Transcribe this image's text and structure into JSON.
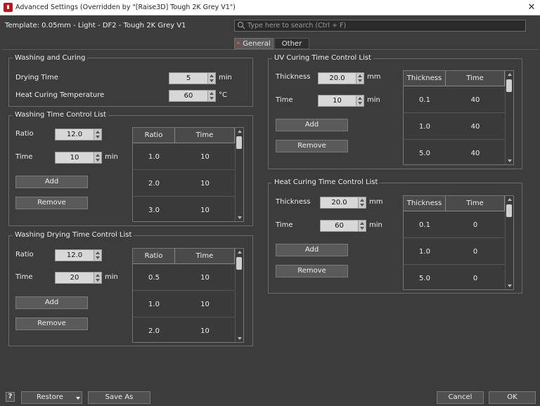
{
  "window": {
    "title": "Advanced Settings (Overridden by \"[Raise3D] Tough 2K Grey V1\")",
    "close_glyph": "✕"
  },
  "template_label": "Template: 0.05mm - Light - DF2 - Tough 2K Grey V1",
  "search": {
    "placeholder": "Type here to search (Ctrl + F)",
    "value": ""
  },
  "tabs": [
    {
      "label": "General",
      "active": true
    },
    {
      "label": "Other",
      "active": false
    }
  ],
  "accent_color": "#e24a3a",
  "washing_curing": {
    "title": "Washing and Curing",
    "drying_time": {
      "label": "Drying Time",
      "value": "5",
      "unit": "min"
    },
    "heat_curing_temp": {
      "label": "Heat Curing Temperature",
      "value": "60",
      "unit": "°C"
    }
  },
  "washing_time": {
    "title": "Washing Time Control List",
    "ratio": {
      "label": "Ratio",
      "value": "12.0"
    },
    "time": {
      "label": "Time",
      "value": "10",
      "unit": "min"
    },
    "add_label": "Add",
    "remove_label": "Remove",
    "columns": [
      "Ratio",
      "Time"
    ],
    "rows": [
      [
        "1.0",
        "10"
      ],
      [
        "2.0",
        "10"
      ],
      [
        "3.0",
        "10"
      ]
    ]
  },
  "washing_drying": {
    "title": "Washing Drying Time Control List",
    "ratio": {
      "label": "Ratio",
      "value": "12.0"
    },
    "time": {
      "label": "Time",
      "value": "20",
      "unit": "min"
    },
    "add_label": "Add",
    "remove_label": "Remove",
    "columns": [
      "Ratio",
      "Time"
    ],
    "rows": [
      [
        "0.5",
        "10"
      ],
      [
        "1.0",
        "10"
      ],
      [
        "2.0",
        "10"
      ]
    ]
  },
  "uv_curing": {
    "title": "UV Curing Time Control List",
    "thickness": {
      "label": "Thickness",
      "value": "20.0",
      "unit": "mm"
    },
    "time": {
      "label": "Time",
      "value": "10",
      "unit": "min"
    },
    "add_label": "Add",
    "remove_label": "Remove",
    "columns": [
      "Thickness",
      "Time"
    ],
    "rows": [
      [
        "0.1",
        "40"
      ],
      [
        "1.0",
        "40"
      ],
      [
        "5.0",
        "40"
      ]
    ]
  },
  "heat_curing": {
    "title": "Heat Curing Time Control List",
    "thickness": {
      "label": "Thickness",
      "value": "20.0",
      "unit": "mm"
    },
    "time": {
      "label": "Time",
      "value": "60",
      "unit": "min"
    },
    "add_label": "Add",
    "remove_label": "Remove",
    "columns": [
      "Thickness",
      "Time"
    ],
    "rows": [
      [
        "0.1",
        "0"
      ],
      [
        "1.0",
        "0"
      ],
      [
        "5.0",
        "0"
      ]
    ]
  },
  "footer": {
    "help": "?",
    "restore": "Restore",
    "save_as": "Save As",
    "cancel": "Cancel",
    "ok": "OK"
  }
}
